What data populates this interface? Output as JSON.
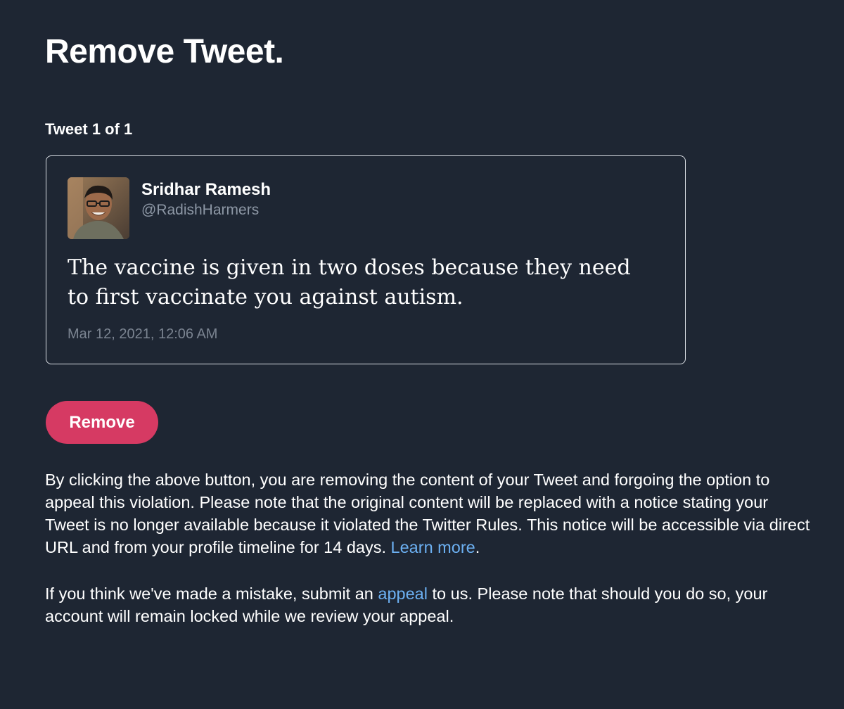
{
  "page": {
    "title": "Remove Tweet.",
    "tweet_count": "Tweet 1 of 1"
  },
  "tweet": {
    "author_name": "Sridhar Ramesh",
    "author_handle": "@RadishHarmers",
    "text": "The vaccine is given in two doses because they need to first vaccinate you against autism.",
    "date": "Mar 12, 2021, 12:06 AM",
    "avatar_icon": "user-avatar-photo"
  },
  "actions": {
    "remove_label": "Remove"
  },
  "notice": {
    "paragraph1_text": "By clicking the above button, you are removing the content of your Tweet and forgoing the option to appeal this violation. Please note that the original content will be replaced with a notice stating your Tweet is no longer available because it violated the Twitter Rules. This notice will be accessible via direct URL and from your profile timeline for 14 days. ",
    "paragraph1_link": "Learn more",
    "paragraph1_end": ".",
    "paragraph2_before": "If you think we've made a mistake, submit an ",
    "paragraph2_link": "appeal",
    "paragraph2_after": " to us. Please note that should you do so, your account will remain locked while we review your appeal."
  },
  "colors": {
    "background": "#1e2633",
    "button": "#d63a63",
    "link": "#6cb0f2",
    "handle": "#8d97a5",
    "card_border": "#d9dde3"
  }
}
